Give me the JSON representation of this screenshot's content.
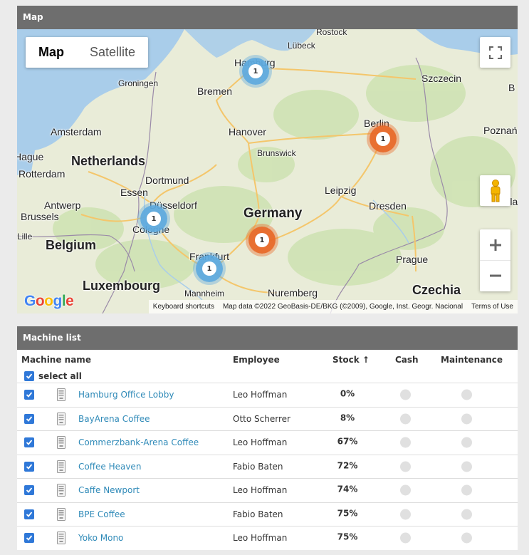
{
  "map": {
    "title": "Map",
    "map_type": [
      "Map",
      "Satellite"
    ],
    "cities": [
      {
        "name": "Rostock",
        "size": "s"
      },
      {
        "name": "Lübeck",
        "size": "s"
      },
      {
        "name": "Hamburg",
        "size": "m"
      },
      {
        "name": "Szczecin",
        "size": "m"
      },
      {
        "name": "Groningen",
        "size": "s"
      },
      {
        "name": "Bremen",
        "size": "m"
      },
      {
        "name": "Amsterdam",
        "size": "m"
      },
      {
        "name": "Hanover",
        "size": "m"
      },
      {
        "name": "Berlin",
        "size": "m"
      },
      {
        "name": "Poznań",
        "size": "m"
      },
      {
        "name": "Hague",
        "size": "m"
      },
      {
        "name": "Netherlands",
        "size": "l"
      },
      {
        "name": "Brunswick",
        "size": "s"
      },
      {
        "name": "Rotterdam",
        "size": "m"
      },
      {
        "name": "Dortmund",
        "size": "m"
      },
      {
        "name": "Essen",
        "size": "m"
      },
      {
        "name": "Leipzig",
        "size": "m"
      },
      {
        "name": "Antwerp",
        "size": "m"
      },
      {
        "name": "Düsseldorf",
        "size": "m"
      },
      {
        "name": "Germany",
        "size": "xl"
      },
      {
        "name": "Dresden",
        "size": "m"
      },
      {
        "name": "Brussels",
        "size": "m"
      },
      {
        "name": "Cologne",
        "size": "m"
      },
      {
        "name": "Lille",
        "size": "s"
      },
      {
        "name": "Belgium",
        "size": "l"
      },
      {
        "name": "Frankfurt",
        "size": "m"
      },
      {
        "name": "Prague",
        "size": "m"
      },
      {
        "name": "Luxembourg",
        "size": "l"
      },
      {
        "name": "Mannheim",
        "size": "s"
      },
      {
        "name": "Nuremberg",
        "size": "m"
      },
      {
        "name": "Czechia",
        "size": "l"
      },
      {
        "name": "Wroclaw",
        "size": "m"
      },
      {
        "name": "B",
        "size": "m"
      }
    ],
    "clusters": [
      {
        "count": "1",
        "color": "blue"
      },
      {
        "count": "1",
        "color": "orange"
      },
      {
        "count": "1",
        "color": "blue"
      },
      {
        "count": "1",
        "color": "orange"
      },
      {
        "count": "1",
        "color": "blue"
      }
    ],
    "google_logo": "Google",
    "attribution": [
      "Keyboard shortcuts",
      "Map data ©2022 GeoBasis-DE/BKG (©2009), Google, Inst. Geogr. Nacional",
      "Terms of Use"
    ]
  },
  "list": {
    "title": "Machine list",
    "headers": {
      "name": "Machine name",
      "employee": "Employee",
      "stock": "Stock ↑",
      "cash": "Cash",
      "maintenance": "Maintenance"
    },
    "select_all": "select all",
    "rows": [
      {
        "name": "Hamburg Office Lobby",
        "employee": "Leo Hoffman",
        "stock": "0%",
        "stock_value": 0
      },
      {
        "name": "BayArena Coffee",
        "employee": "Otto Scherrer",
        "stock": "8%",
        "stock_value": 8
      },
      {
        "name": "Commerzbank-Arena Coffee",
        "employee": "Leo Hoffman",
        "stock": "67%",
        "stock_value": 67
      },
      {
        "name": "Coffee Heaven",
        "employee": "Fabio Baten",
        "stock": "72%",
        "stock_value": 72
      },
      {
        "name": "Caffe Newport",
        "employee": "Leo Hoffman",
        "stock": "74%",
        "stock_value": 74
      },
      {
        "name": "BPE Coffee",
        "employee": "Fabio Baten",
        "stock": "75%",
        "stock_value": 75
      },
      {
        "name": "Yoko Mono",
        "employee": "Leo Hoffman",
        "stock": "75%",
        "stock_value": 75
      }
    ]
  },
  "colors": {
    "header_bg": "#6e6e6e",
    "link": "#2f8ab8",
    "checkbox": "#2f78d8",
    "stock_fill": "#4caf50"
  }
}
